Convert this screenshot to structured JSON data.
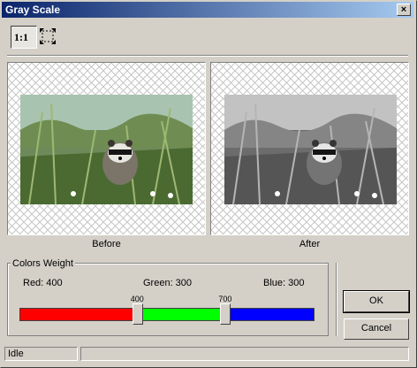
{
  "window": {
    "title": "Gray Scale",
    "close_glyph": "×"
  },
  "toolbar": {
    "actual_size_label": "1:1",
    "fit_icon": "fit-to-window-icon"
  },
  "preview": {
    "before_caption": "Before",
    "after_caption": "After"
  },
  "colors_weight": {
    "legend": "Colors Weight",
    "red_label": "Red: 400",
    "green_label": "Green: 300",
    "blue_label": "Blue: 300",
    "red_value": 400,
    "green_value": 300,
    "blue_value": 300,
    "total": 1000,
    "thumb1_label": "400",
    "thumb2_label": "700",
    "colors": {
      "red": "#ff0000",
      "green": "#00ff00",
      "blue": "#0000ff"
    }
  },
  "buttons": {
    "ok_label": "OK",
    "cancel_label": "Cancel"
  },
  "statusbar": {
    "status_text": "Idle",
    "info_text": ""
  }
}
